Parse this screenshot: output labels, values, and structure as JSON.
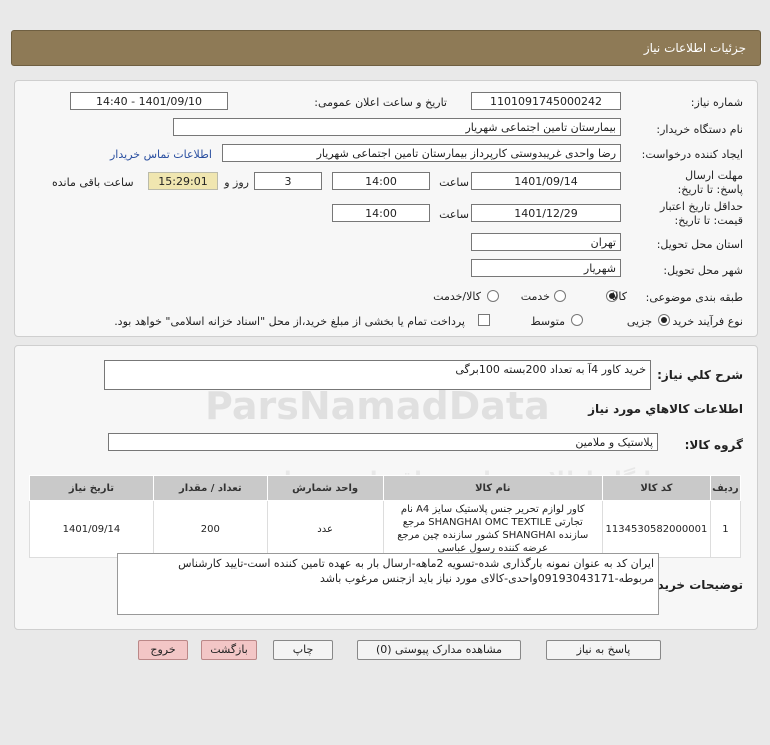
{
  "header": {
    "title": "جزئیات اطلاعات نیاز"
  },
  "form": {
    "need_number_label": "شماره نیاز:",
    "need_number": "1101091745000242",
    "announce_label": "تاریخ و ساعت اعلان عمومی:",
    "announce_value": "1401/09/10 - 14:40",
    "buyer_org_label": "نام دستگاه خریدار:",
    "buyer_org": "بیمارستان تامین اجتماعی شهریار",
    "creator_label": "ایجاد کننده درخواست:",
    "creator": "رضا واحدی غریبدوستی کارپرداز بیمارستان تامین اجتماعی شهریار",
    "contact_link": "اطلاعات تماس خریدار",
    "deadline_label": "مهلت ارسال پاسخ: تا تاریخ:",
    "deadline_date": "1401/09/14",
    "time_label": "ساعت",
    "deadline_time": "14:00",
    "days_value": "3",
    "days_label": "روز و",
    "remaining_time": "15:29:01",
    "remaining_label": "ساعت باقی مانده",
    "validity_label": "حداقل تاریخ اعتبار قیمت: تا تاریخ:",
    "validity_date": "1401/12/29",
    "validity_time": "14:00",
    "province_label": "استان محل تحویل:",
    "province": "تهران",
    "city_label": "شهر محل تحویل:",
    "city": "شهریار",
    "category_label": "طبقه بندی موضوعی:",
    "category_options": [
      "کالا",
      "خدمت",
      "کالا/خدمت"
    ],
    "process_label": "نوع فرآیند خرید :",
    "process_options": [
      "جزیی",
      "متوسط"
    ],
    "payment_note": "پرداخت تمام یا بخشی از مبلغ خرید،از محل \"اسناد خزانه اسلامی\" خواهد بود."
  },
  "description": {
    "label": "شرح کلي نياز:",
    "value": "خرید کاور 4آ به تعداد 200بسته 100برگی"
  },
  "goods": {
    "section_title": "اطلاعات کالاهاي مورد نياز",
    "group_label": "گروه کالا:",
    "group_value": "پلاستیک و ملامین"
  },
  "table": {
    "headers": [
      "ردیف",
      "کد کالا",
      "نام کالا",
      "واحد شمارش",
      "تعداد / مقدار",
      "تاریخ نیاز"
    ],
    "rows": [
      {
        "row": "1",
        "code": "1134530582000001",
        "name": "کاور لوازم تحریر جنس پلاستیک سایز A4 نام تجارتی SHANGHAI OMC TEXTILE مرجع سازنده SHANGHAI کشور سازنده چین مرجع عرضه کننده رسول عباسی",
        "unit": "عدد",
        "qty": "200",
        "date": "1401/09/14"
      }
    ]
  },
  "buyer_notes": {
    "label": "توضیحات خریدار:",
    "value": "ایران کد به عنوان نمونه بارگذاری شده-تسویه 2ماهه-ارسال بار به عهده تامین کننده است-تایید کارشناس مربوطه-09193043171واحدی-کالای مورد نیاز باید ازجنس مرغوب باشد"
  },
  "buttons": {
    "reply": "پاسخ به نیاز",
    "attachments": "مشاهده مدارک پیوستی (0)",
    "print": "چاپ",
    "back": "بازگشت",
    "exit": "خروج"
  },
  "watermark": {
    "brand": "ParsNamadData",
    "line1": "پایگاه اطلاع رسانی مناقصات و مزایده",
    "line2": "مرکز فراوری اطلاعات پارس نماد داده"
  }
}
